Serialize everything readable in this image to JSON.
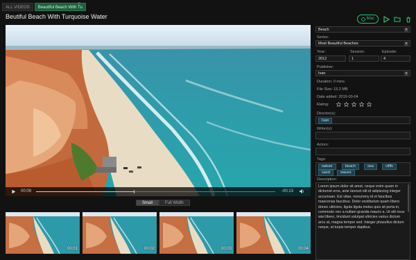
{
  "tabs": [
    {
      "label": "ALL VIDEOS",
      "active": false
    },
    {
      "label": "Beautiful Beach With Tu",
      "active": true
    }
  ],
  "tab_close": "×",
  "title": "Beutiful Beach With Turquoise Water",
  "toolbar": {
    "mac_label": "Mac",
    "icons": [
      "mac-icon",
      "play-icon",
      "folder-icon",
      "trash-icon"
    ]
  },
  "player": {
    "current_time": "00:09",
    "remaining_time": "-00:13",
    "progress": 0.41
  },
  "size_toggle": {
    "small": "Small",
    "full": "Full Width",
    "selected": "small"
  },
  "thumbnails": [
    {
      "time": "00:01"
    },
    {
      "time": "00:02"
    },
    {
      "time": "00:03"
    },
    {
      "time": "00:04"
    }
  ],
  "panel": {
    "category": "Beach",
    "series_label": "Series:",
    "series": "Most Beautiful Beaches",
    "year_label": "Year:",
    "year": "2012",
    "session_label": "Session:",
    "session": "1",
    "episode_label": "Episode:",
    "episode": "4",
    "publisher_label": "Publisher:",
    "publisher": "Ivan",
    "duration": "Duration: 0 mins",
    "file_size": "File Size: 15.2 MB",
    "date_added": "Date added: 2019-03-04",
    "rating_label": "Rating:",
    "rating": 0,
    "directors_label": "Director(s):",
    "directors": [
      "Ivan"
    ],
    "writers_label": "Writer(s):",
    "actors_label": "Actors:",
    "tags_label": "Tags:",
    "tags": [
      "nature",
      "beach",
      "sea",
      "cliffs",
      "sand",
      "waves"
    ],
    "description_label": "Description:",
    "description": "Lorem ipsum dolor sit amet, neque enim quam in dictumst eros, ante laoreet elit id adipiscing integer accumsan. Est vitae, nonummy id et faucibus maecenas faucibus. Dolor vestibulum quam libero donec ultricies, ligula ligula metus quis sit porta in, commodo nec a nullam gravida mauris a. Ut elit risus wisi libero, tincidunt volutpat ultricies varius dictum arcu at, magna tempor sed. Integer phasellus dictum neque, at turpis tempor dapibus."
  },
  "colors": {
    "accent_green": "#2fbf71",
    "chip_blue": "#1e3f4c"
  }
}
